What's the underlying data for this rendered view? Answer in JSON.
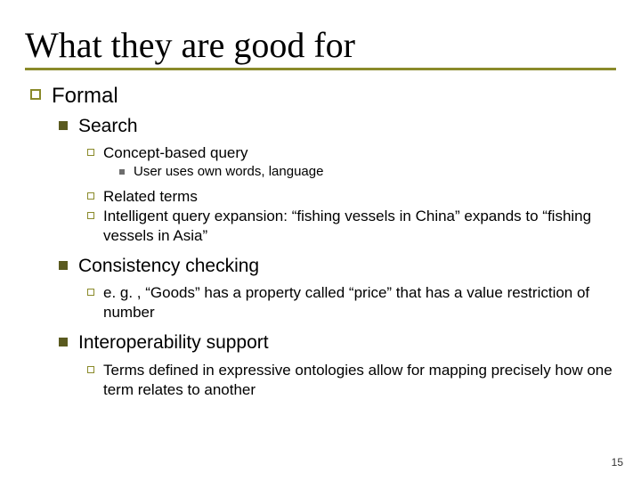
{
  "title": "What they are good for",
  "page_number": "15",
  "lvl1": {
    "label": "Formal"
  },
  "sections": [
    {
      "heading": "Search",
      "points": [
        {
          "text": "Concept-based query",
          "sub": [
            "User uses own words, language"
          ]
        },
        {
          "text": "Related terms"
        },
        {
          "text": "Intelligent query expansion:  “fishing vessels in China” expands to “fishing vessels in Asia”"
        }
      ]
    },
    {
      "heading": "Consistency checking",
      "points": [
        {
          "text": "e. g. , “Goods” has a property called “price” that has a value restriction of number"
        }
      ]
    },
    {
      "heading": "Interoperability support",
      "points": [
        {
          "text": "Terms defined in expressive ontologies allow for mapping precisely how one term relates to another"
        }
      ]
    }
  ]
}
